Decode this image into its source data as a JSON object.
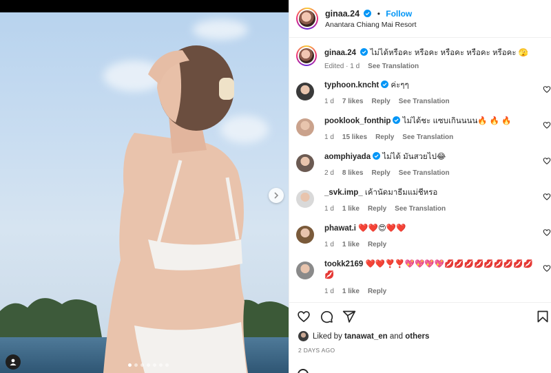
{
  "post": {
    "username": "ginaa.24",
    "follow_label": "Follow",
    "separator": "•",
    "location": "Anantara Chiang Mai Resort",
    "carousel_count": 7,
    "carousel_active": 1
  },
  "caption": {
    "username": "ginaa.24",
    "text": "ไม่ได้หรือคะ หรือคะ หรือคะ หรือคะ หรือคะ 🫣",
    "edited": "Edited · 1 d",
    "see_translation": "See Translation"
  },
  "comments": [
    {
      "username": "typhoon.kncht",
      "verified": true,
      "text": "ค่ะๆๆ",
      "time": "1 d",
      "likes": "7 likes",
      "reply": "Reply",
      "translate": "See Translation"
    },
    {
      "username": "pooklook_fonthip",
      "verified": true,
      "text": "ไม่ได้ชะ แซบเกินนนน🔥 🔥 🔥",
      "time": "1 d",
      "likes": "15 likes",
      "reply": "Reply",
      "translate": "See Translation"
    },
    {
      "username": "aomphiyada",
      "verified": true,
      "text": "ไม่ได้ มันสวยไป😂",
      "time": "2 d",
      "likes": "8 likes",
      "reply": "Reply",
      "translate": "See Translation"
    },
    {
      "username": "_svk.imp_",
      "verified": false,
      "text": "เค้านัดมาธีมแม่ชีหรอ",
      "time": "1 d",
      "likes": "1 like",
      "reply": "Reply",
      "translate": "See Translation"
    },
    {
      "username": "phawat.i",
      "verified": false,
      "text": "❤️❤️😍❤️❤️",
      "time": "1 d",
      "likes": "1 like",
      "reply": "Reply",
      "translate": ""
    },
    {
      "username": "tookk2169",
      "verified": false,
      "text": "❤️❤️❣️❣️💖💖💖💖💋💋💋💋💋💋💋💋💋💋",
      "time": "1 d",
      "likes": "1 like",
      "reply": "Reply",
      "translate": ""
    }
  ],
  "likes": {
    "prefix": "Liked by",
    "user": "tanawat_en",
    "and": "and",
    "others": "others"
  },
  "posted_ago": "2 DAYS AGO",
  "colors": {
    "accent": "#0095f6",
    "verified": "#0095f6",
    "muted": "#737373"
  }
}
